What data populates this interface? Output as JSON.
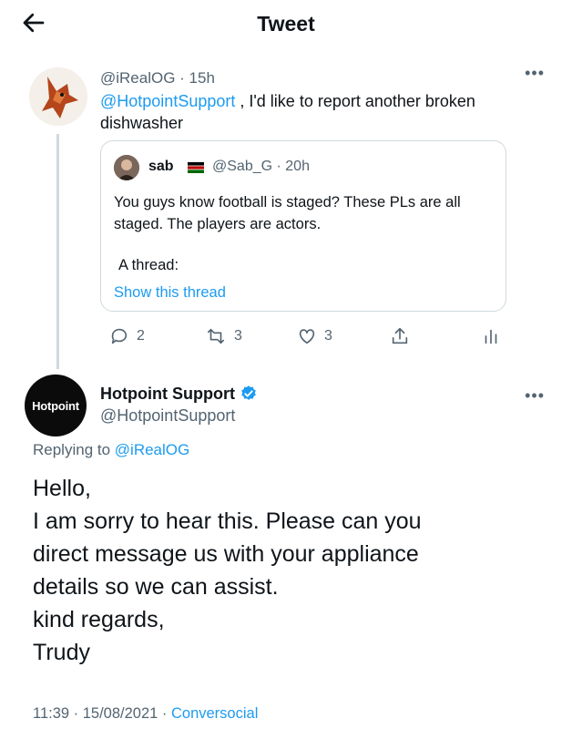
{
  "header": {
    "title": "Tweet",
    "back_icon": "back-arrow-icon"
  },
  "parent_tweet": {
    "handle": "@iRealOG",
    "time": " · 15h",
    "mention": "@HotpointSupport",
    "text_after_mention": " , I'd like to report another broken dishwasher",
    "quoted": {
      "name": "sab",
      "handle_time": "@Sab_G · 20h",
      "text": "You guys know football is staged? These PLs are all staged. The players are actors.",
      "thread_label": "A thread:",
      "show_thread": "Show this thread"
    },
    "actions": {
      "replies": "2",
      "retweets": "3",
      "likes": "3"
    }
  },
  "main_tweet": {
    "name": "Hotpoint Support",
    "handle": "@HotpointSupport",
    "avatar_text": "Hotpoint",
    "replying_prefix": "Replying to ",
    "replying_to": "@iRealOG",
    "body_lines": [
      "Hello,",
      "I am sorry to hear this. Please can you",
      "direct message us with your appliance",
      "details so we can assist.",
      "kind regards,",
      "Trudy"
    ],
    "timestamp": "11:39 · 15/08/2021 · ",
    "source": "Conversocial"
  },
  "colors": {
    "accent": "#1d9bf0",
    "muted": "#536471",
    "border": "#cfd9de"
  }
}
